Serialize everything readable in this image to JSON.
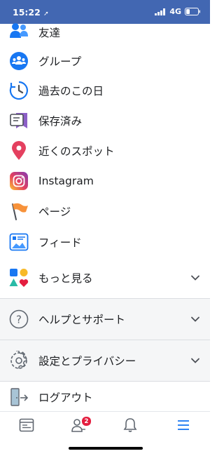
{
  "status_bar": {
    "time": "15:22",
    "network": "4G"
  },
  "menu_items": [
    {
      "label": "友達",
      "icon": "friends-icon"
    },
    {
      "label": "グループ",
      "icon": "groups-icon"
    },
    {
      "label": "過去のこの日",
      "icon": "memories-icon"
    },
    {
      "label": "保存済み",
      "icon": "saved-icon"
    },
    {
      "label": "近くのスポット",
      "icon": "nearby-places-icon"
    },
    {
      "label": "Instagram",
      "icon": "instagram-icon"
    },
    {
      "label": "ページ",
      "icon": "pages-flag-icon"
    },
    {
      "label": "フィード",
      "icon": "feeds-icon"
    }
  ],
  "see_more": {
    "label": "もっと見る",
    "icon": "shapes-icon"
  },
  "sections": [
    {
      "label": "ヘルプとサポート",
      "icon": "help-question-icon"
    },
    {
      "label": "設定とプライバシー",
      "icon": "settings-gear-icon"
    }
  ],
  "logout": {
    "label": "ログアウト",
    "icon": "logout-door-icon"
  },
  "tab_bar": {
    "tabs": [
      "news-feed-tab-icon",
      "friend-requests-tab-icon",
      "notifications-tab-icon",
      "menu-tab-icon"
    ],
    "friend_requests_badge": "2",
    "accent_color": "#1877f2"
  }
}
